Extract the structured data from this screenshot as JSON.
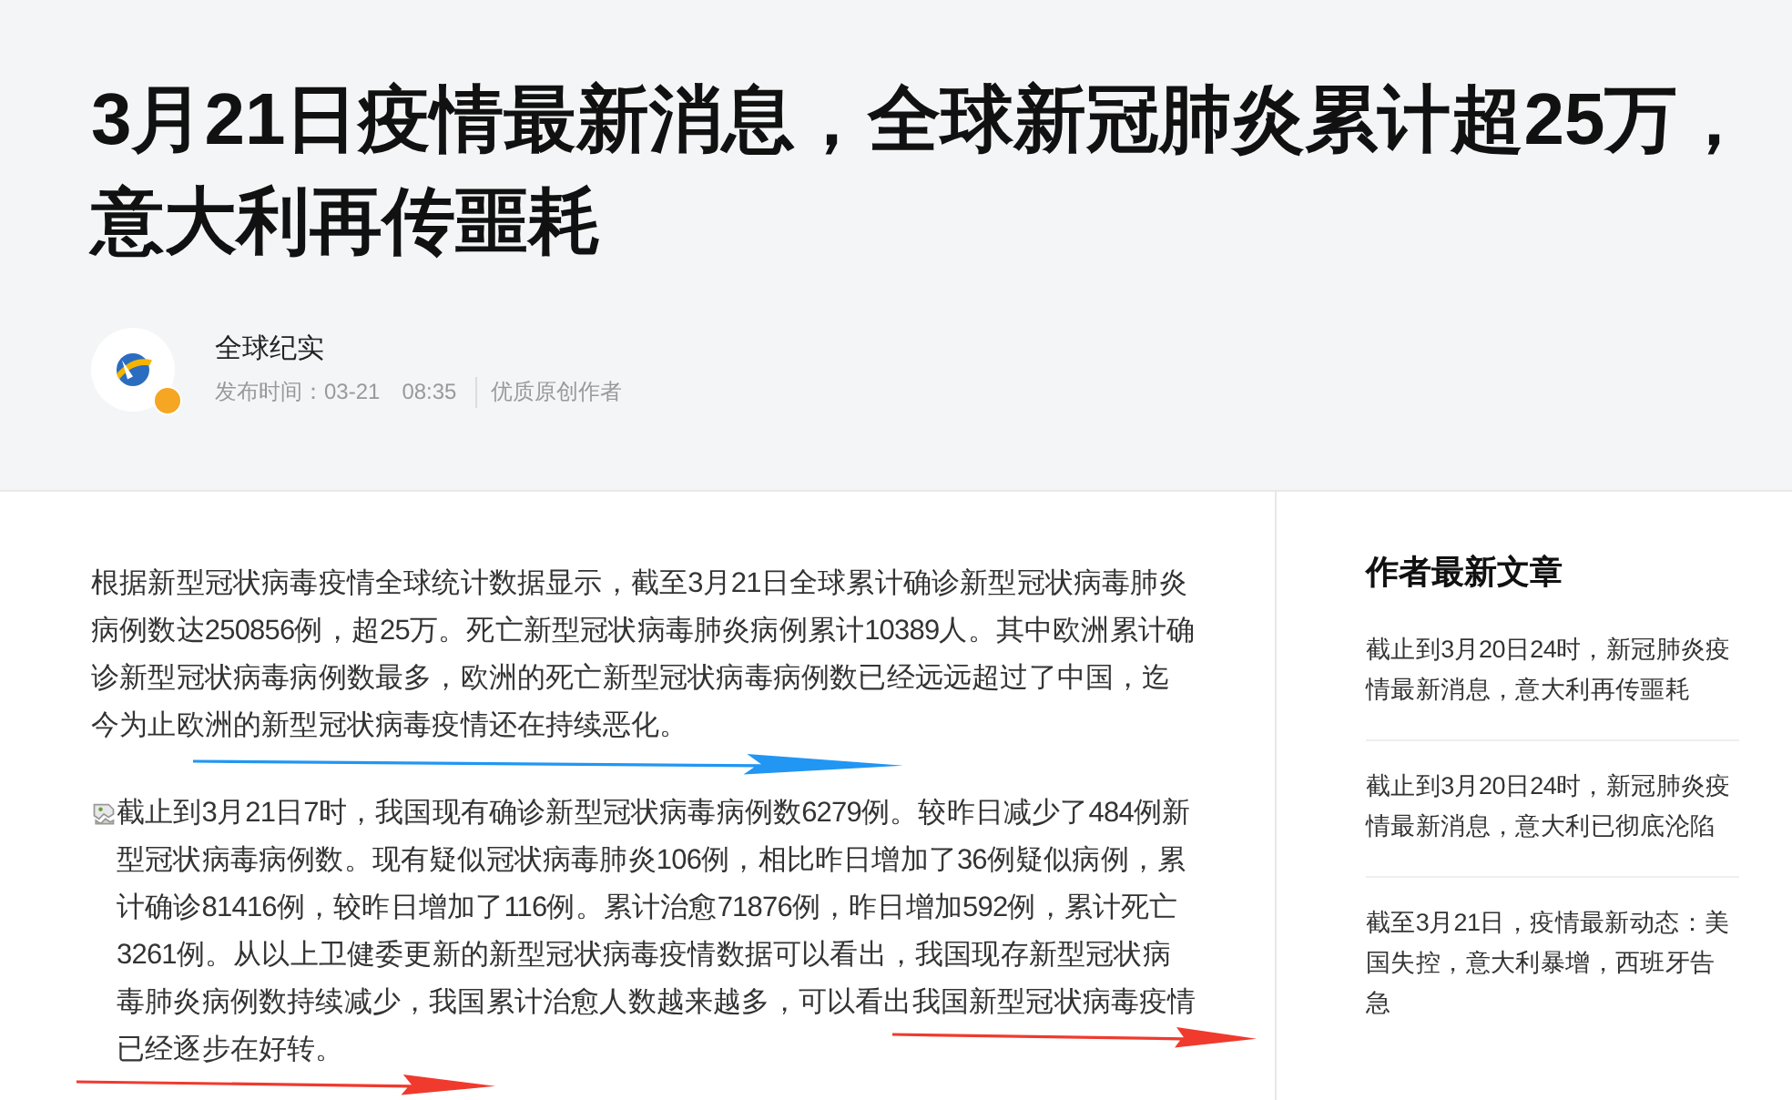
{
  "article": {
    "title": "3月21日疫情最新消息，全球新冠肺炎累计超25万，意大利再传噩耗",
    "author": {
      "name": "全球纪实",
      "verified": true,
      "published": "发布时间：03-21　08:35",
      "tag": "优质原创作者"
    },
    "paragraphs": [
      {
        "kind": "text",
        "text": "根据新型冠状病毒疫情全球统计数据显示，截至3月21日全球累计确诊新型冠状病毒肺炎病例数达250856例，超25万。死亡新型冠状病毒肺炎病例累计10389人。其中欧洲累计确诊新型冠状病毒病例数最多，欧洲的死亡新型冠状病毒病例数已经远远超过了中国，迄今为止欧洲的新型冠状病毒疫情还在持续恶化。",
        "arrows": [
          {
            "color": "#2196f3"
          }
        ]
      },
      {
        "kind": "broken-image",
        "text": "截止到3月21日7时，我国现有确诊新型冠状病毒病例数6279例。较昨日减少了484例新型冠状病毒病例数。现有疑似冠状病毒肺炎106例，相比昨日增加了36例疑似病例，累计确诊81416例，较昨日增加了116例。累计治愈71876例，昨日增加592例，累计死亡3261例。从以上卫健委更新的新型冠状病毒疫情数据可以看出，我国现存新型冠状病毒肺炎病例数持续减少，我国累计治愈人数越来越多，可以看出我国新型冠状病毒疫情已经逐步在好转。",
        "arrows": [
          {
            "color": "#f03a2e"
          },
          {
            "color": "#f03a2e"
          }
        ]
      }
    ]
  },
  "sidebar": {
    "title": "作者最新文章",
    "items": [
      {
        "title": "截止到3月20日24时，新冠肺炎疫情最新消息，意大利再传噩耗"
      },
      {
        "title": "截止到3月20日24时，新冠肺炎疫情最新消息，意大利已彻底沦陷"
      },
      {
        "title": "截至3月21日，疫情最新动态：美国失控，意大利暴增，西班牙告急"
      }
    ]
  }
}
